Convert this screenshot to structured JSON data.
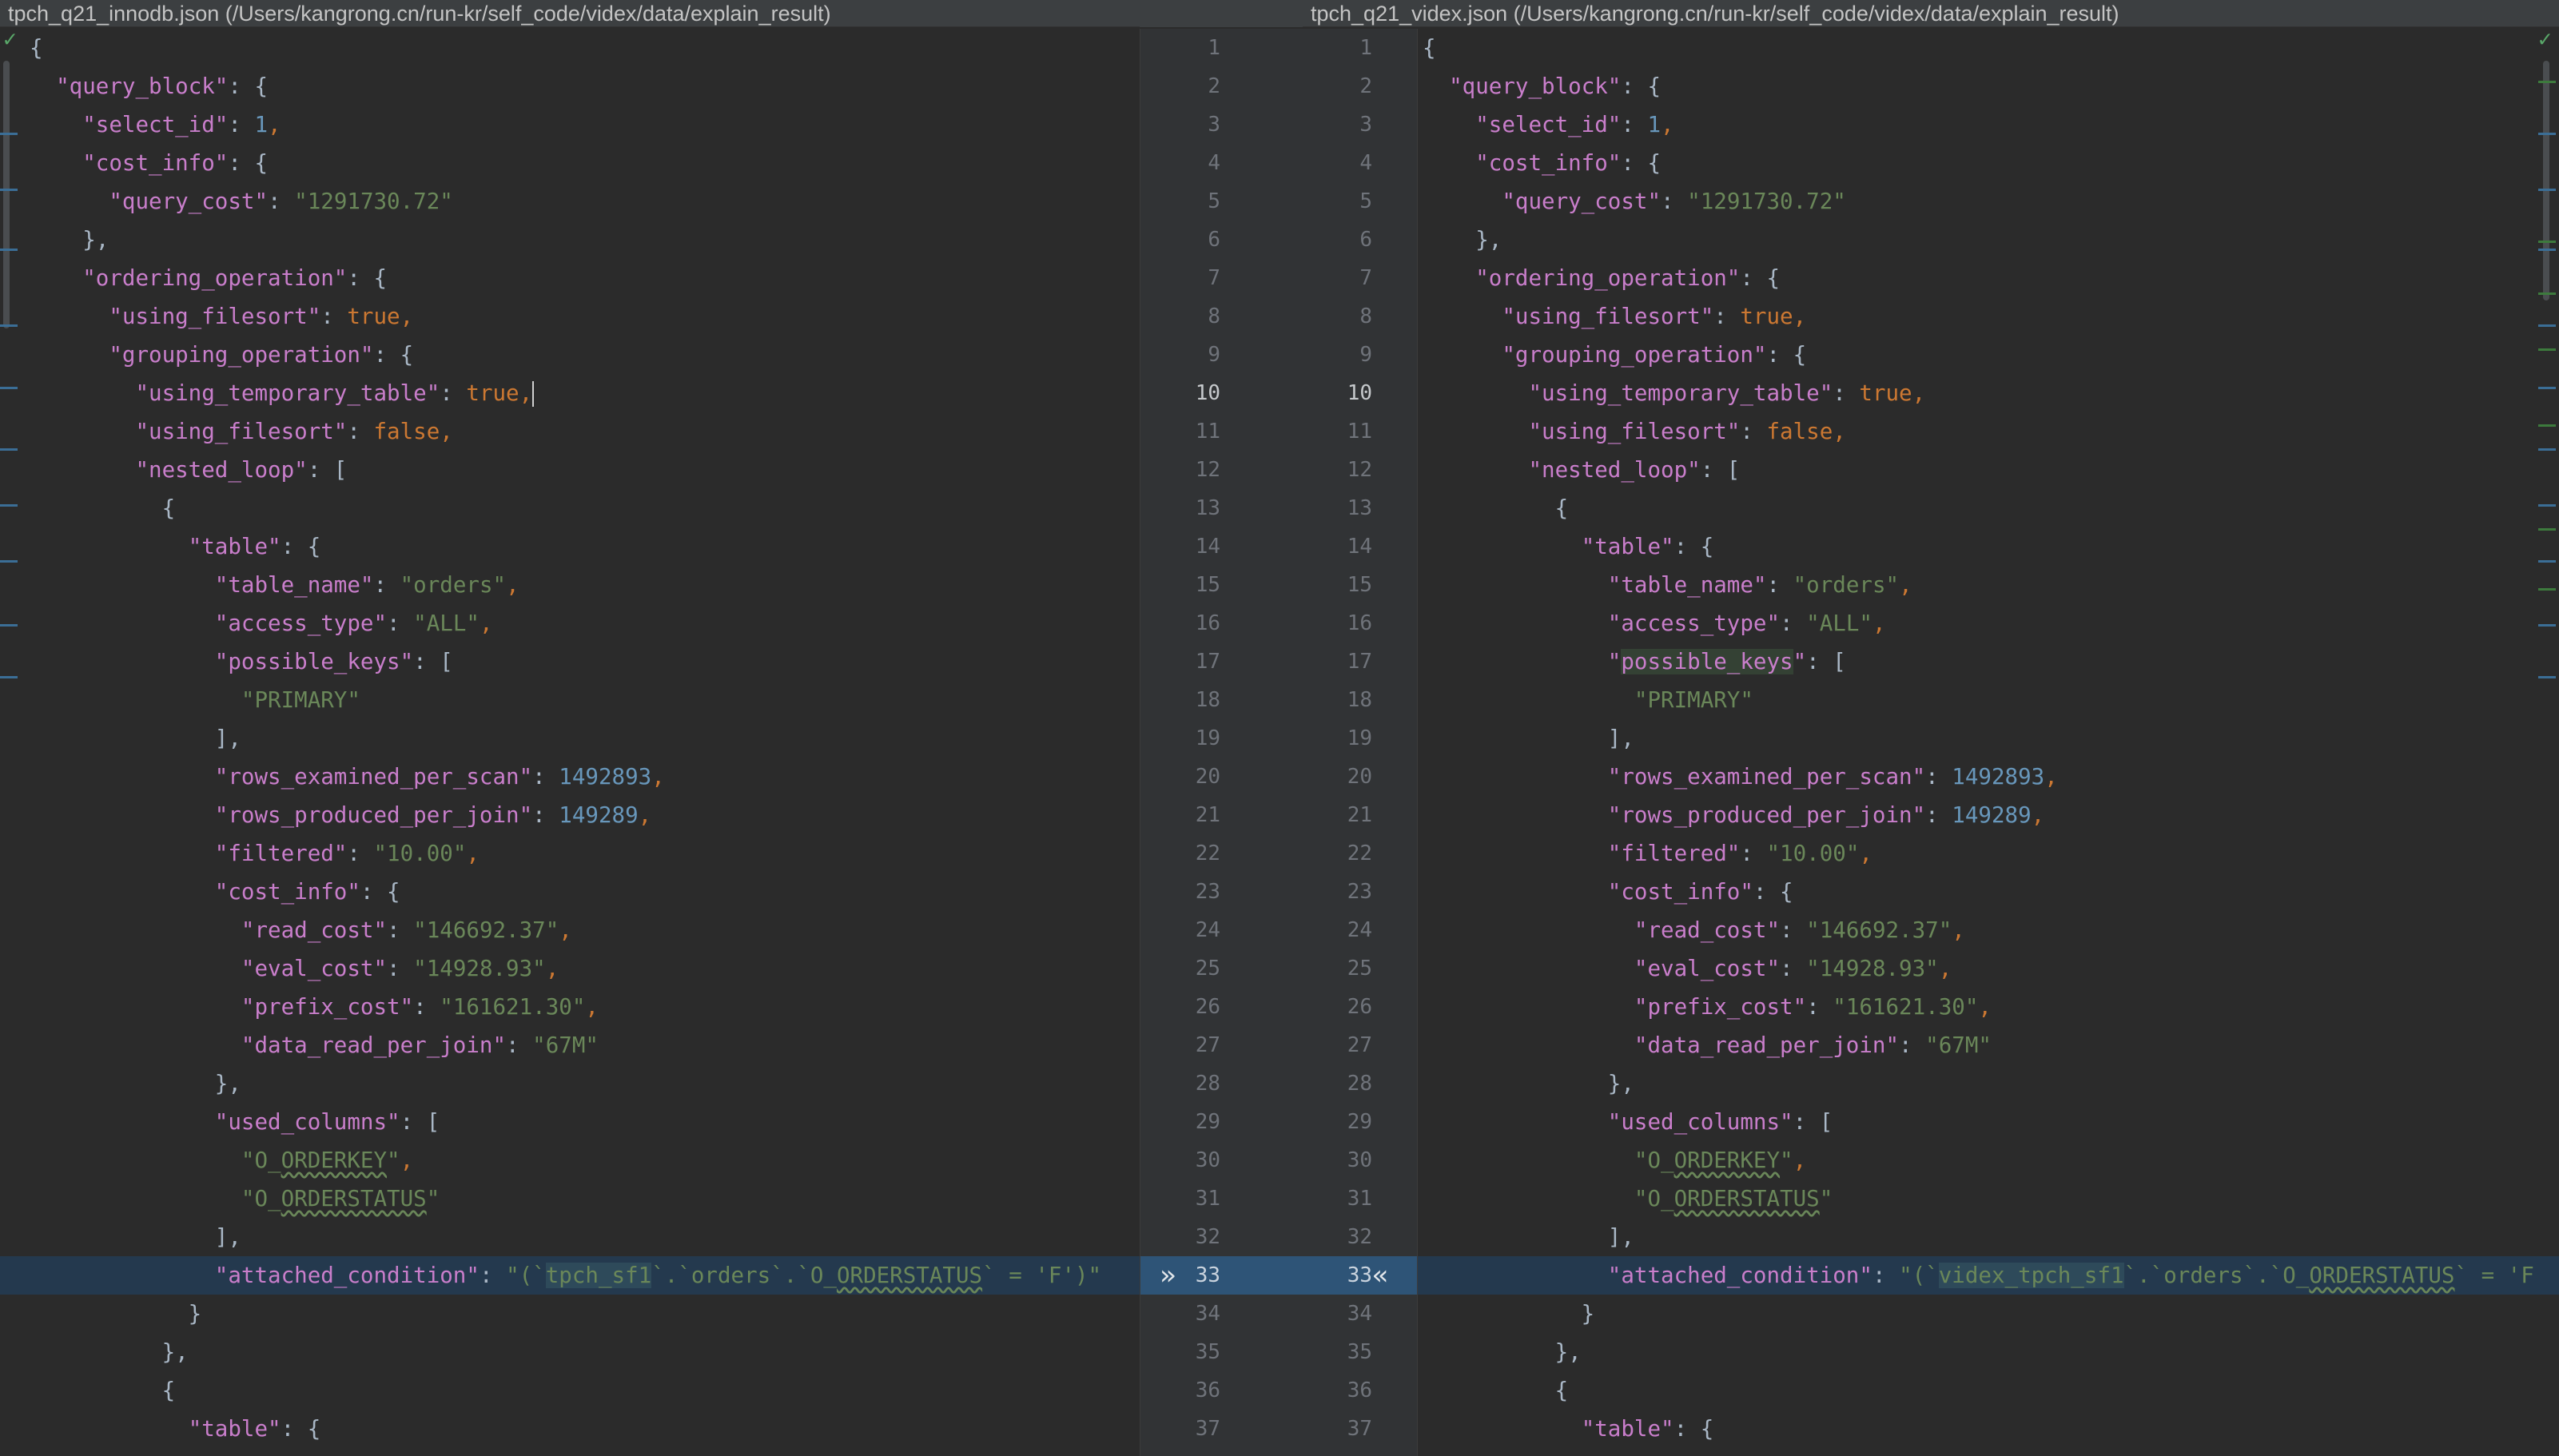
{
  "headers": {
    "left": "tpch_q21_innodb.json (/Users/kangrong.cn/run-kr/self_code/videx/data/explain_result)",
    "right": "tpch_q21_videx.json (/Users/kangrong.cn/run-kr/self_code/videx/data/explain_result)"
  },
  "gutter": {
    "current_line": 10,
    "diff_line": 33,
    "arrow_left": "»",
    "arrow_right": "«"
  },
  "left_lines": [
    [
      [
        "t",
        "{"
      ]
    ],
    [
      [
        "t",
        "  "
      ],
      [
        "k",
        "\"query_block\""
      ],
      [
        "t",
        ": {"
      ]
    ],
    [
      [
        "t",
        "    "
      ],
      [
        "k",
        "\"select_id\""
      ],
      [
        "t",
        ": "
      ],
      [
        "n",
        "1"
      ],
      [
        "p",
        ","
      ]
    ],
    [
      [
        "t",
        "    "
      ],
      [
        "k",
        "\"cost_info\""
      ],
      [
        "t",
        ": {"
      ]
    ],
    [
      [
        "t",
        "      "
      ],
      [
        "k",
        "\"query_cost\""
      ],
      [
        "t",
        ": "
      ],
      [
        "s",
        "\"1291730.72\""
      ]
    ],
    [
      [
        "t",
        "    },"
      ]
    ],
    [
      [
        "t",
        "    "
      ],
      [
        "k",
        "\"ordering_operation\""
      ],
      [
        "t",
        ": {"
      ]
    ],
    [
      [
        "t",
        "      "
      ],
      [
        "k",
        "\"using_filesort\""
      ],
      [
        "t",
        ": "
      ],
      [
        "b",
        "true"
      ],
      [
        "p",
        ","
      ]
    ],
    [
      [
        "t",
        "      "
      ],
      [
        "k",
        "\"grouping_operation\""
      ],
      [
        "t",
        ": {"
      ]
    ],
    [
      [
        "t",
        "        "
      ],
      [
        "k",
        "\"using_temporary_table\""
      ],
      [
        "t",
        ": "
      ],
      [
        "b",
        "true"
      ],
      [
        "p",
        ","
      ],
      [
        "caret",
        ""
      ]
    ],
    [
      [
        "t",
        "        "
      ],
      [
        "k",
        "\"using_filesort\""
      ],
      [
        "t",
        ": "
      ],
      [
        "b",
        "false"
      ],
      [
        "p",
        ","
      ]
    ],
    [
      [
        "t",
        "        "
      ],
      [
        "k",
        "\"nested_loop\""
      ],
      [
        "t",
        ": ["
      ]
    ],
    [
      [
        "t",
        "          {"
      ]
    ],
    [
      [
        "t",
        "            "
      ],
      [
        "k",
        "\"table\""
      ],
      [
        "t",
        ": {"
      ]
    ],
    [
      [
        "t",
        "              "
      ],
      [
        "k",
        "\"table_name\""
      ],
      [
        "t",
        ": "
      ],
      [
        "s",
        "\"orders\""
      ],
      [
        "p",
        ","
      ]
    ],
    [
      [
        "t",
        "              "
      ],
      [
        "k",
        "\"access_type\""
      ],
      [
        "t",
        ": "
      ],
      [
        "s",
        "\"ALL\""
      ],
      [
        "p",
        ","
      ]
    ],
    [
      [
        "t",
        "              "
      ],
      [
        "k",
        "\"possible_keys\""
      ],
      [
        "t",
        ": ["
      ]
    ],
    [
      [
        "t",
        "                "
      ],
      [
        "s",
        "\"PRIMARY\""
      ]
    ],
    [
      [
        "t",
        "              ],"
      ]
    ],
    [
      [
        "t",
        "              "
      ],
      [
        "k",
        "\"rows_examined_per_scan\""
      ],
      [
        "t",
        ": "
      ],
      [
        "n",
        "1492893"
      ],
      [
        "p",
        ","
      ]
    ],
    [
      [
        "t",
        "              "
      ],
      [
        "k",
        "\"rows_produced_per_join\""
      ],
      [
        "t",
        ": "
      ],
      [
        "n",
        "149289"
      ],
      [
        "p",
        ","
      ]
    ],
    [
      [
        "t",
        "              "
      ],
      [
        "k",
        "\"filtered\""
      ],
      [
        "t",
        ": "
      ],
      [
        "s",
        "\"10.00\""
      ],
      [
        "p",
        ","
      ]
    ],
    [
      [
        "t",
        "              "
      ],
      [
        "k",
        "\"cost_info\""
      ],
      [
        "t",
        ": {"
      ]
    ],
    [
      [
        "t",
        "                "
      ],
      [
        "k",
        "\"read_cost\""
      ],
      [
        "t",
        ": "
      ],
      [
        "s",
        "\"146692.37\""
      ],
      [
        "p",
        ","
      ]
    ],
    [
      [
        "t",
        "                "
      ],
      [
        "k",
        "\"eval_cost\""
      ],
      [
        "t",
        ": "
      ],
      [
        "s",
        "\"14928.93\""
      ],
      [
        "p",
        ","
      ]
    ],
    [
      [
        "t",
        "                "
      ],
      [
        "k",
        "\"prefix_cost\""
      ],
      [
        "t",
        ": "
      ],
      [
        "s",
        "\"161621.30\""
      ],
      [
        "p",
        ","
      ]
    ],
    [
      [
        "t",
        "                "
      ],
      [
        "k",
        "\"data_read_per_join\""
      ],
      [
        "t",
        ": "
      ],
      [
        "s",
        "\"67M\""
      ]
    ],
    [
      [
        "t",
        "              },"
      ]
    ],
    [
      [
        "t",
        "              "
      ],
      [
        "k",
        "\"used_columns\""
      ],
      [
        "t",
        ": ["
      ]
    ],
    [
      [
        "t",
        "                "
      ],
      [
        "s",
        "\"O_"
      ],
      [
        "su",
        "ORDERKEY"
      ],
      [
        "s",
        "\""
      ],
      [
        "p",
        ","
      ]
    ],
    [
      [
        "t",
        "                "
      ],
      [
        "s",
        "\"O_"
      ],
      [
        "su",
        "ORDERSTATUS"
      ],
      [
        "s",
        "\""
      ]
    ],
    [
      [
        "t",
        "              ],"
      ]
    ],
    [
      [
        "t",
        "              "
      ],
      [
        "k",
        "\"attached_condition\""
      ],
      [
        "t",
        ": "
      ],
      [
        "s",
        "\"(`"
      ],
      [
        "sm",
        "tpch_sf1"
      ],
      [
        "s",
        "`.`orders`.`O_"
      ],
      [
        "su",
        "ORDERSTATUS"
      ],
      [
        "s",
        "` = 'F')\""
      ]
    ],
    [
      [
        "t",
        "            }"
      ]
    ],
    [
      [
        "t",
        "          },"
      ]
    ],
    [
      [
        "t",
        "          {"
      ]
    ],
    [
      [
        "t",
        "            "
      ],
      [
        "k",
        "\"table\""
      ],
      [
        "t",
        ": {"
      ]
    ]
  ],
  "right_lines": [
    [
      [
        "t",
        "{"
      ]
    ],
    [
      [
        "t",
        "  "
      ],
      [
        "k",
        "\"query_block\""
      ],
      [
        "t",
        ": {"
      ]
    ],
    [
      [
        "t",
        "    "
      ],
      [
        "k",
        "\"select_id\""
      ],
      [
        "t",
        ": "
      ],
      [
        "n",
        "1"
      ],
      [
        "p",
        ","
      ]
    ],
    [
      [
        "t",
        "    "
      ],
      [
        "k",
        "\"cost_info\""
      ],
      [
        "t",
        ": {"
      ]
    ],
    [
      [
        "t",
        "      "
      ],
      [
        "k",
        "\"query_cost\""
      ],
      [
        "t",
        ": "
      ],
      [
        "s",
        "\"1291730.72\""
      ]
    ],
    [
      [
        "t",
        "    },"
      ]
    ],
    [
      [
        "t",
        "    "
      ],
      [
        "k",
        "\"ordering_operation\""
      ],
      [
        "t",
        ": {"
      ]
    ],
    [
      [
        "t",
        "      "
      ],
      [
        "k",
        "\"using_filesort\""
      ],
      [
        "t",
        ": "
      ],
      [
        "b",
        "true"
      ],
      [
        "p",
        ","
      ]
    ],
    [
      [
        "t",
        "      "
      ],
      [
        "k",
        "\"grouping_operation\""
      ],
      [
        "t",
        ": {"
      ]
    ],
    [
      [
        "t",
        "        "
      ],
      [
        "k",
        "\"using_temporary_table\""
      ],
      [
        "t",
        ": "
      ],
      [
        "b",
        "true"
      ],
      [
        "p",
        ","
      ]
    ],
    [
      [
        "t",
        "        "
      ],
      [
        "k",
        "\"using_filesort\""
      ],
      [
        "t",
        ": "
      ],
      [
        "b",
        "false"
      ],
      [
        "p",
        ","
      ]
    ],
    [
      [
        "t",
        "        "
      ],
      [
        "k",
        "\"nested_loop\""
      ],
      [
        "t",
        ": ["
      ]
    ],
    [
      [
        "t",
        "          {"
      ]
    ],
    [
      [
        "t",
        "            "
      ],
      [
        "k",
        "\"table\""
      ],
      [
        "t",
        ": {"
      ]
    ],
    [
      [
        "t",
        "              "
      ],
      [
        "k",
        "\"table_name\""
      ],
      [
        "t",
        ": "
      ],
      [
        "s",
        "\"orders\""
      ],
      [
        "p",
        ","
      ]
    ],
    [
      [
        "t",
        "              "
      ],
      [
        "k",
        "\"access_type\""
      ],
      [
        "t",
        ": "
      ],
      [
        "s",
        "\"ALL\""
      ],
      [
        "p",
        ","
      ]
    ],
    [
      [
        "t",
        "              "
      ],
      [
        "k",
        "\""
      ],
      [
        "km",
        "possible_keys"
      ],
      [
        "k",
        "\""
      ],
      [
        "t",
        ": ["
      ]
    ],
    [
      [
        "t",
        "                "
      ],
      [
        "s",
        "\"PRIMARY\""
      ]
    ],
    [
      [
        "t",
        "              ],"
      ]
    ],
    [
      [
        "t",
        "              "
      ],
      [
        "k",
        "\"rows_examined_per_scan\""
      ],
      [
        "t",
        ": "
      ],
      [
        "n",
        "1492893"
      ],
      [
        "p",
        ","
      ]
    ],
    [
      [
        "t",
        "              "
      ],
      [
        "k",
        "\"rows_produced_per_join\""
      ],
      [
        "t",
        ": "
      ],
      [
        "n",
        "149289"
      ],
      [
        "p",
        ","
      ]
    ],
    [
      [
        "t",
        "              "
      ],
      [
        "k",
        "\"filtered\""
      ],
      [
        "t",
        ": "
      ],
      [
        "s",
        "\"10.00\""
      ],
      [
        "p",
        ","
      ]
    ],
    [
      [
        "t",
        "              "
      ],
      [
        "k",
        "\"cost_info\""
      ],
      [
        "t",
        ": {"
      ]
    ],
    [
      [
        "t",
        "                "
      ],
      [
        "k",
        "\"read_cost\""
      ],
      [
        "t",
        ": "
      ],
      [
        "s",
        "\"146692.37\""
      ],
      [
        "p",
        ","
      ]
    ],
    [
      [
        "t",
        "                "
      ],
      [
        "k",
        "\"eval_cost\""
      ],
      [
        "t",
        ": "
      ],
      [
        "s",
        "\"14928.93\""
      ],
      [
        "p",
        ","
      ]
    ],
    [
      [
        "t",
        "                "
      ],
      [
        "k",
        "\"prefix_cost\""
      ],
      [
        "t",
        ": "
      ],
      [
        "s",
        "\"161621.30\""
      ],
      [
        "p",
        ","
      ]
    ],
    [
      [
        "t",
        "                "
      ],
      [
        "k",
        "\"data_read_per_join\""
      ],
      [
        "t",
        ": "
      ],
      [
        "s",
        "\"67M\""
      ]
    ],
    [
      [
        "t",
        "              },"
      ]
    ],
    [
      [
        "t",
        "              "
      ],
      [
        "k",
        "\"used_columns\""
      ],
      [
        "t",
        ": ["
      ]
    ],
    [
      [
        "t",
        "                "
      ],
      [
        "s",
        "\"O_"
      ],
      [
        "su",
        "ORDERKEY"
      ],
      [
        "s",
        "\""
      ],
      [
        "p",
        ","
      ]
    ],
    [
      [
        "t",
        "                "
      ],
      [
        "s",
        "\"O_"
      ],
      [
        "su",
        "ORDERSTATUS"
      ],
      [
        "s",
        "\""
      ]
    ],
    [
      [
        "t",
        "              ],"
      ]
    ],
    [
      [
        "t",
        "              "
      ],
      [
        "k",
        "\"attached_condition\""
      ],
      [
        "t",
        ": "
      ],
      [
        "s",
        "\"(`"
      ],
      [
        "sm",
        "videx_tpch_sf1"
      ],
      [
        "s",
        "`.`orders`.`O_"
      ],
      [
        "su",
        "ORDERSTATUS"
      ],
      [
        "s",
        "` = 'F"
      ]
    ],
    [
      [
        "t",
        "            }"
      ]
    ],
    [
      [
        "t",
        "          },"
      ]
    ],
    [
      [
        "t",
        "          {"
      ]
    ],
    [
      [
        "t",
        "            "
      ],
      [
        "k",
        "\"table\""
      ],
      [
        "t",
        ": {"
      ]
    ]
  ]
}
